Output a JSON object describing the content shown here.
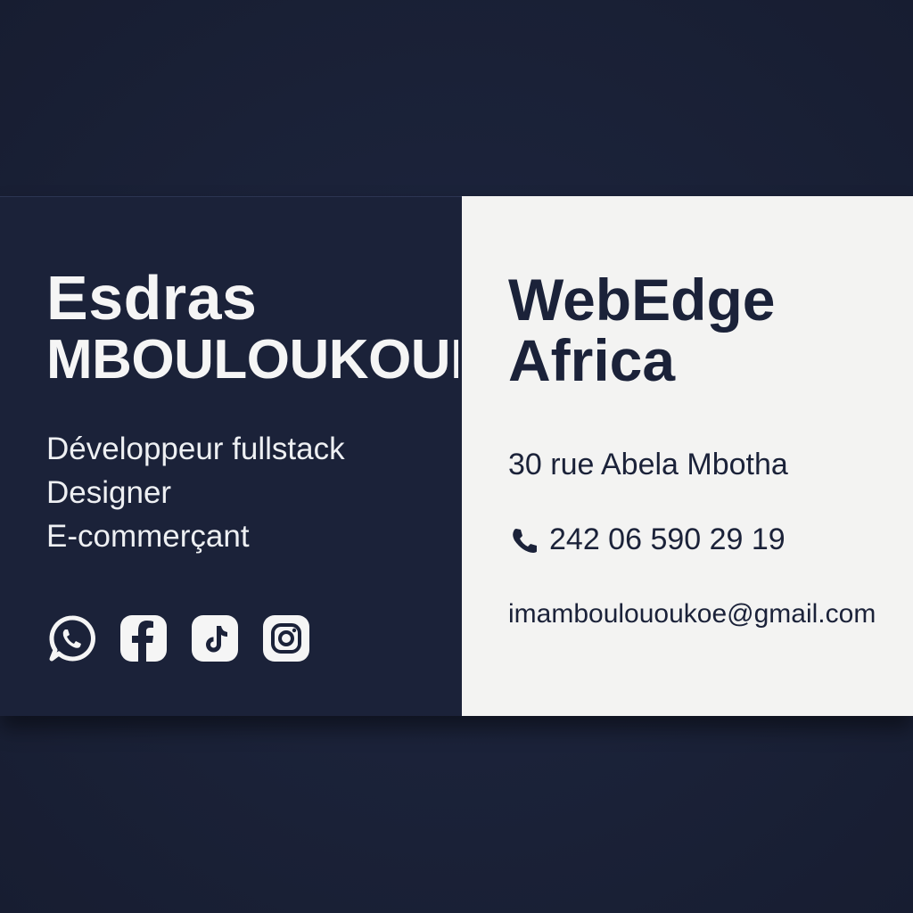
{
  "card": {
    "left": {
      "first_name": "Esdras",
      "last_name": "MBOULOUKOUE",
      "roles": [
        "Développeur fullstack",
        "Designer",
        "E-commerçant"
      ],
      "social_icons": [
        "whatsapp-icon",
        "facebook-icon",
        "tiktok-icon",
        "instagram-icon"
      ]
    },
    "right": {
      "company_line1": "WebEdge",
      "company_line2": "Africa",
      "address": "30 rue Abela Mbotha",
      "phone_icon": "phone-icon",
      "phone": "242 06 590 29 19",
      "email": "imamboulououkoe@gmail.com"
    }
  },
  "colors": {
    "navy": "#1b2239",
    "paper": "#f3f3f2",
    "light_text": "#f5f5f5"
  }
}
